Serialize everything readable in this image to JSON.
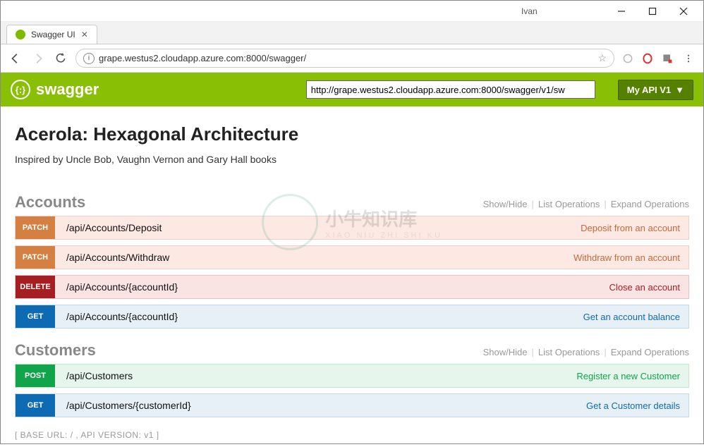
{
  "window": {
    "user": "Ivan"
  },
  "tab": {
    "title": "Swagger UI"
  },
  "addressbar": {
    "url": "grape.westus2.cloudapp.azure.com:8000/swagger/"
  },
  "swagger_header": {
    "brand": "swagger",
    "spec_url": "http://grape.westus2.cloudapp.azure.com:8000/swagger/v1/sw",
    "api_selector": "My API V1"
  },
  "page": {
    "title": "Acerola: Hexagonal Architecture",
    "subtitle": "Inspired by Uncle Bob, Vaughn Vernon and Gary Hall books"
  },
  "section_links": {
    "show_hide": "Show/Hide",
    "list_ops": "List Operations",
    "expand_ops": "Expand Operations"
  },
  "sections": [
    {
      "name": "Accounts",
      "ops": [
        {
          "method": "PATCH",
          "cls": "op-patch",
          "path": "/api/Accounts/Deposit",
          "summary": "Deposit from an account"
        },
        {
          "method": "PATCH",
          "cls": "op-patch",
          "path": "/api/Accounts/Withdraw",
          "summary": "Withdraw from an account"
        },
        {
          "method": "DELETE",
          "cls": "op-delete",
          "path": "/api/Accounts/{accountId}",
          "summary": "Close an account"
        },
        {
          "method": "GET",
          "cls": "op-get",
          "path": "/api/Accounts/{accountId}",
          "summary": "Get an account balance"
        }
      ]
    },
    {
      "name": "Customers",
      "ops": [
        {
          "method": "POST",
          "cls": "op-post",
          "path": "/api/Customers",
          "summary": "Register a new Customer"
        },
        {
          "method": "GET",
          "cls": "op-get",
          "path": "/api/Customers/{customerId}",
          "summary": "Get a Customer details"
        }
      ]
    }
  ],
  "footer": {
    "base_url_line": "[ BASE URL: / , API VERSION: v1 ]"
  }
}
